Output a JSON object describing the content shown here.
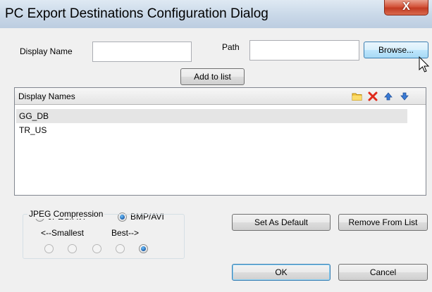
{
  "window": {
    "title": "PC Export Destinations Configuration Dialog",
    "close_glyph": "X"
  },
  "form": {
    "display_name_label": "Display Name",
    "display_name_value": "",
    "path_label": "Path",
    "path_value": "",
    "browse_label": "Browse...",
    "add_to_list_label": "Add to list"
  },
  "list": {
    "header": "Display Names",
    "toolbar_icons": [
      "folder-icon",
      "delete-icon",
      "move-up-icon",
      "move-down-icon"
    ],
    "items": [
      "GG_DB",
      "TR_US"
    ],
    "selected_index": 0
  },
  "format": {
    "options": [
      "JPEG/AVI",
      "BMP/AVI"
    ],
    "selected": "BMP/AVI"
  },
  "compression": {
    "legend": "JPEG Compression",
    "smallest_label": "<--Smallest",
    "best_label": "Best-->",
    "levels": 5,
    "selected_level": 5
  },
  "buttons": {
    "set_default_label": "Set As Default",
    "remove_label": "Remove From List",
    "ok_label": "OK",
    "cancel_label": "Cancel"
  },
  "colors": {
    "close_button": "#c23b22",
    "focus_border": "#3c7fb1",
    "selected_row": "#e5e5e5"
  }
}
